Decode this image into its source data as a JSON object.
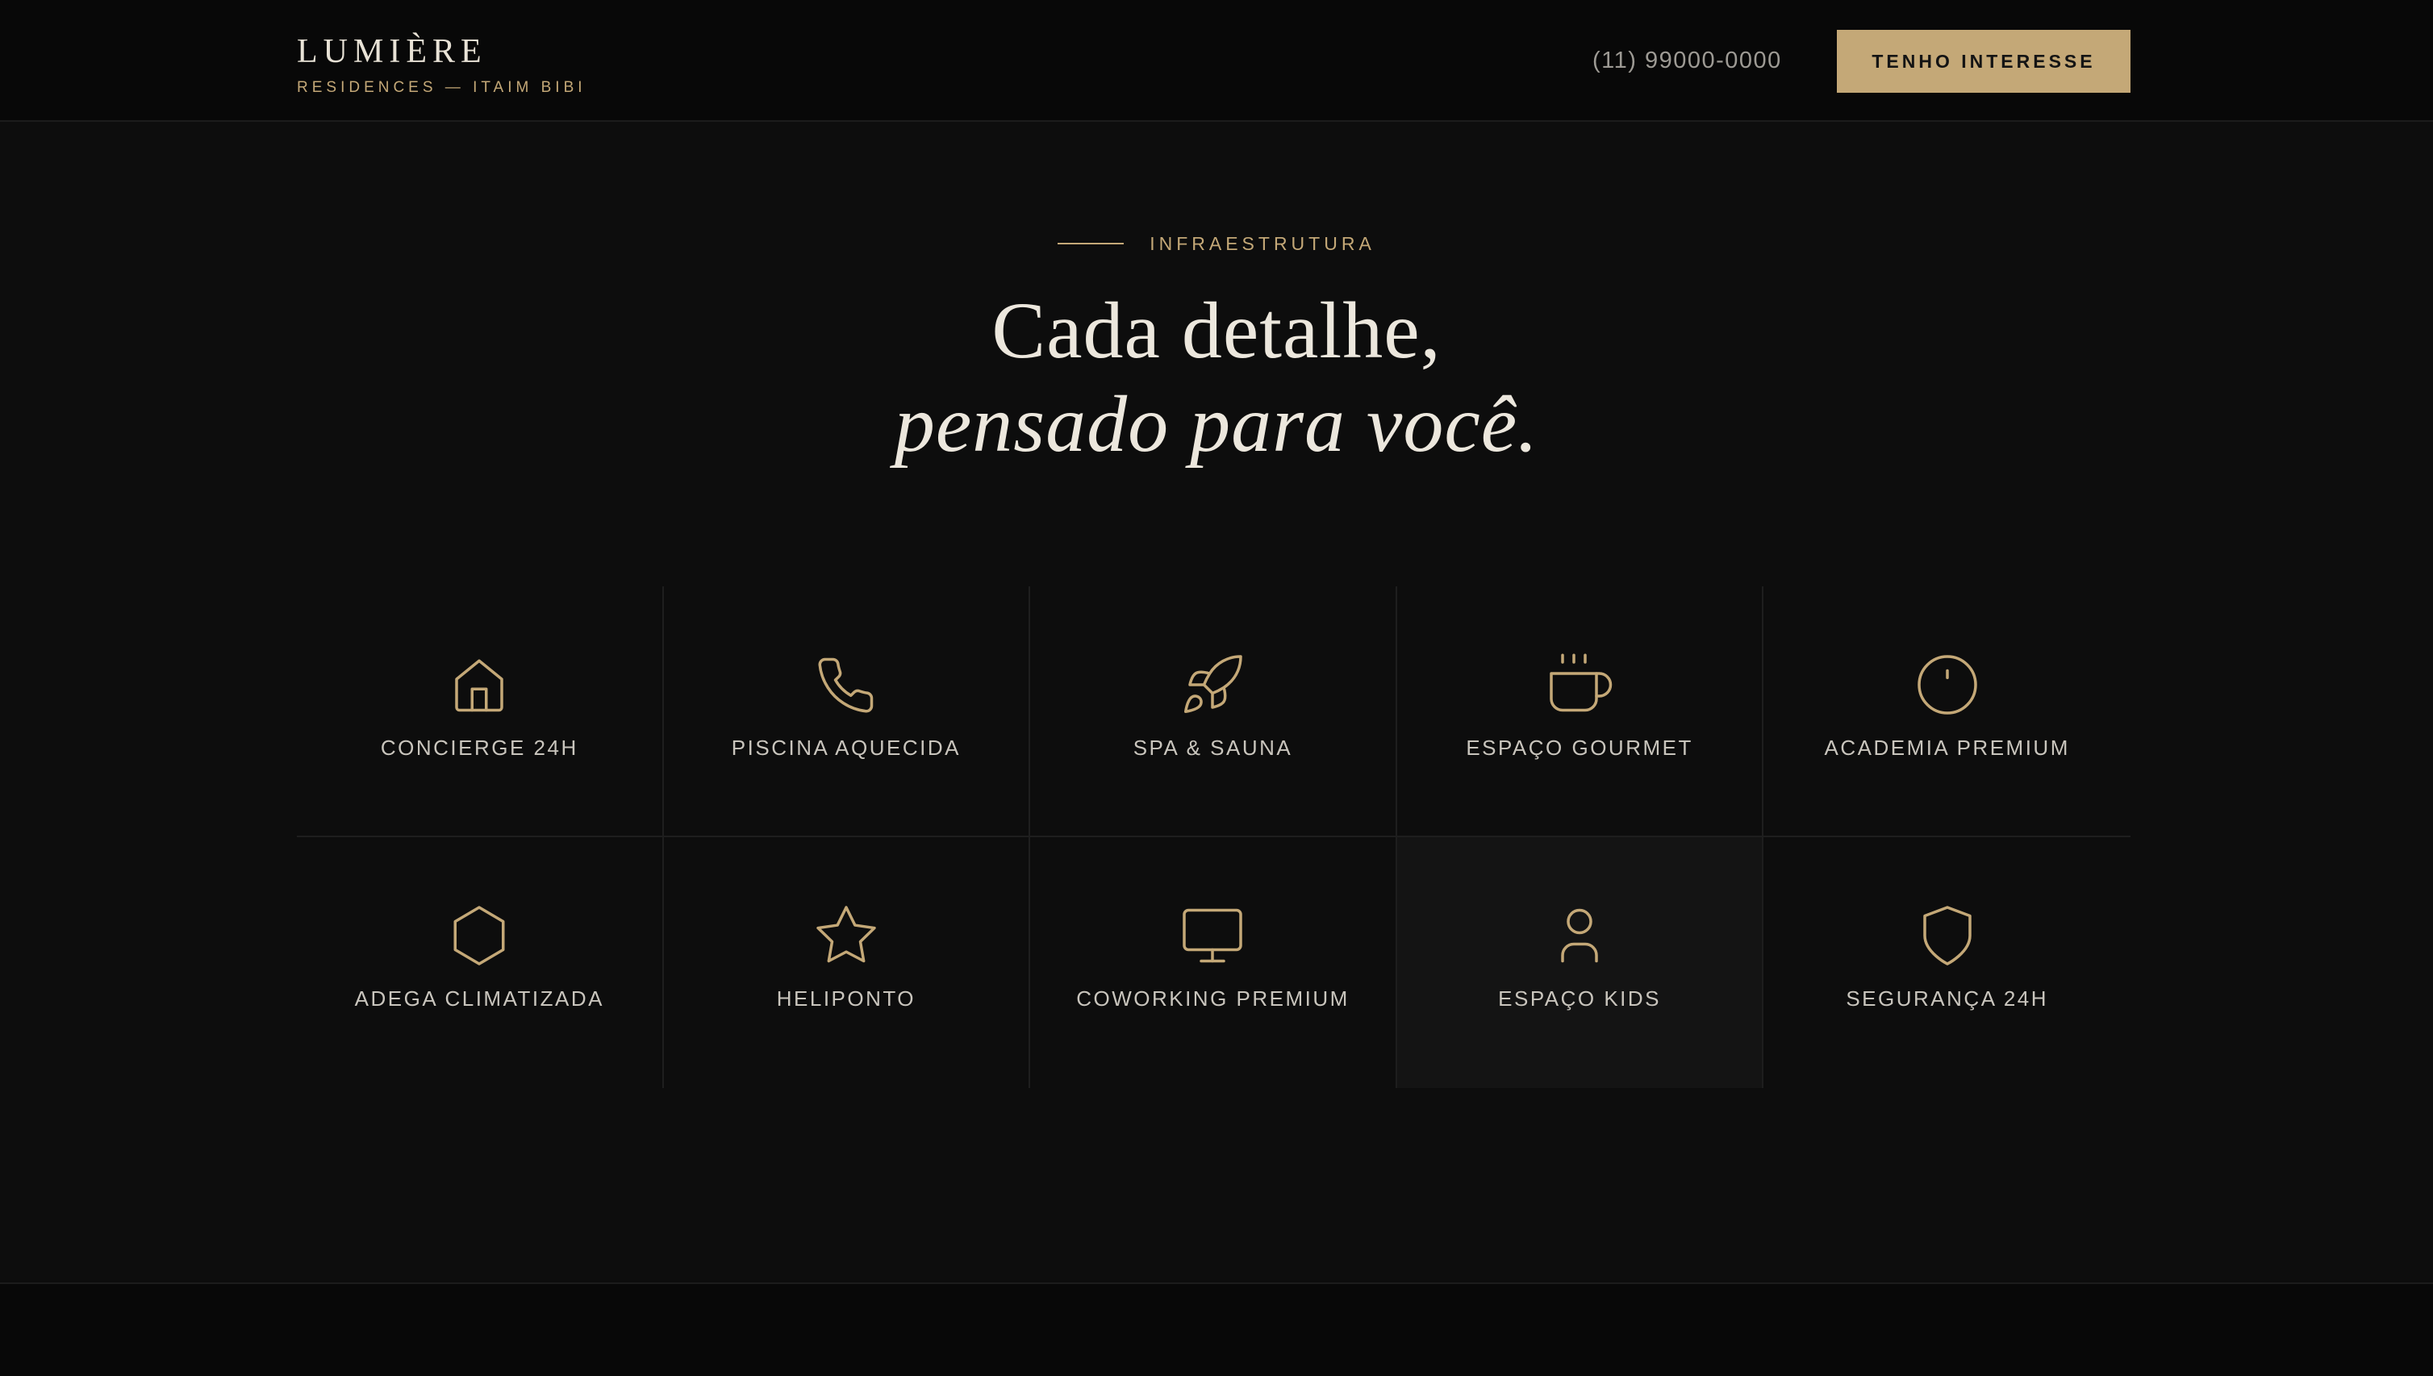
{
  "header": {
    "brand_name": "LUMIÈRE",
    "brand_sub": "RESIDENCES — ITAIM BIBI",
    "phone": "(11) 99000-0000",
    "cta_label": "TENHO INTERESSE"
  },
  "section": {
    "eyebrow": "INFRAESTRUTURA",
    "title_line1": "Cada detalhe,",
    "title_line2": "pensado para você."
  },
  "amenities": [
    {
      "label": "CONCIERGE 24H",
      "icon": "home-icon"
    },
    {
      "label": "PISCINA AQUECIDA",
      "icon": "phone-icon"
    },
    {
      "label": "SPA & SAUNA",
      "icon": "rocket-icon"
    },
    {
      "label": "ESPAÇO GOURMET",
      "icon": "coffee-icon"
    },
    {
      "label": "ACADEMIA PREMIUM",
      "icon": "clock-icon"
    },
    {
      "label": "ADEGA CLIMATIZADA",
      "icon": "hexagon-icon"
    },
    {
      "label": "HELIPONTO",
      "icon": "star-icon"
    },
    {
      "label": "COWORKING PREMIUM",
      "icon": "monitor-icon"
    },
    {
      "label": "ESPAÇO KIDS",
      "icon": "user-icon"
    },
    {
      "label": "SEGURANÇA 24H",
      "icon": "shield-icon"
    }
  ],
  "colors": {
    "background": "#0d0d0d",
    "header_background": "#080808",
    "accent_gold": "#c4a877",
    "text_light": "#ece7dd",
    "highlight_cell": "#141414"
  }
}
